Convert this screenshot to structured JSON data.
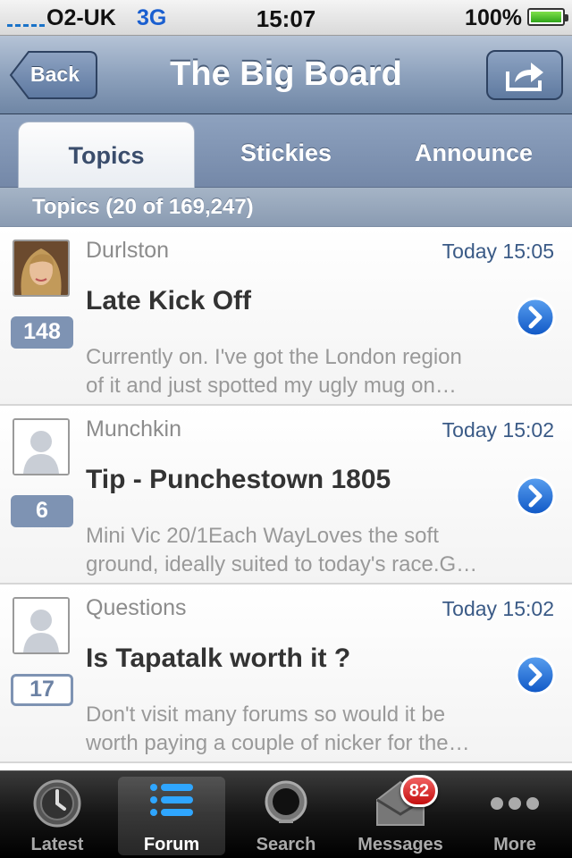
{
  "status_bar": {
    "carrier": "O2-UK",
    "network": "3G",
    "time": "15:07",
    "battery": "100%"
  },
  "nav": {
    "back_label": "Back",
    "title": "The Big Board",
    "share_icon": "share-icon"
  },
  "tabs": [
    {
      "label": "Topics",
      "active": true
    },
    {
      "label": "Stickies",
      "active": false
    },
    {
      "label": "Announce",
      "active": false
    }
  ],
  "section": {
    "header": "Topics (20 of 169,247)"
  },
  "topics": [
    {
      "author": "Durlston",
      "time": "Today 15:05",
      "title": "Late Kick Off",
      "replies": "148",
      "snippet_line1": "Currently on. I've got the London region",
      "snippet_line2": "of it and just spotted my ugly mug on…",
      "avatar": "photo"
    },
    {
      "author": "Munchkin",
      "time": "Today 15:02",
      "title": "Tip - Punchestown 1805",
      "replies": "6",
      "snippet_line1": "Mini Vic 20/1Each WayLoves the soft",
      "snippet_line2": "ground, ideally suited to today's race.G…",
      "avatar": "placeholder"
    },
    {
      "author": "Questions",
      "time": "Today 15:02",
      "title": "Is Tapatalk worth it ?",
      "replies": "17",
      "snippet_line1": "Don't visit many forums so would it be",
      "snippet_line2": "worth paying a couple of nicker for the…",
      "avatar": "placeholder"
    }
  ],
  "tab_bar": [
    {
      "label": "Latest",
      "icon": "clock-icon"
    },
    {
      "label": "Forum",
      "icon": "list-icon",
      "active": true
    },
    {
      "label": "Search",
      "icon": "search-icon"
    },
    {
      "label": "Messages",
      "icon": "envelope-icon",
      "badge": "82"
    },
    {
      "label": "More",
      "icon": "more-dots-icon"
    }
  ],
  "colors": {
    "nav_blue": "#8ea2bd",
    "accent_blue": "#1a6fd8",
    "badge_red": "#d01a1a"
  }
}
